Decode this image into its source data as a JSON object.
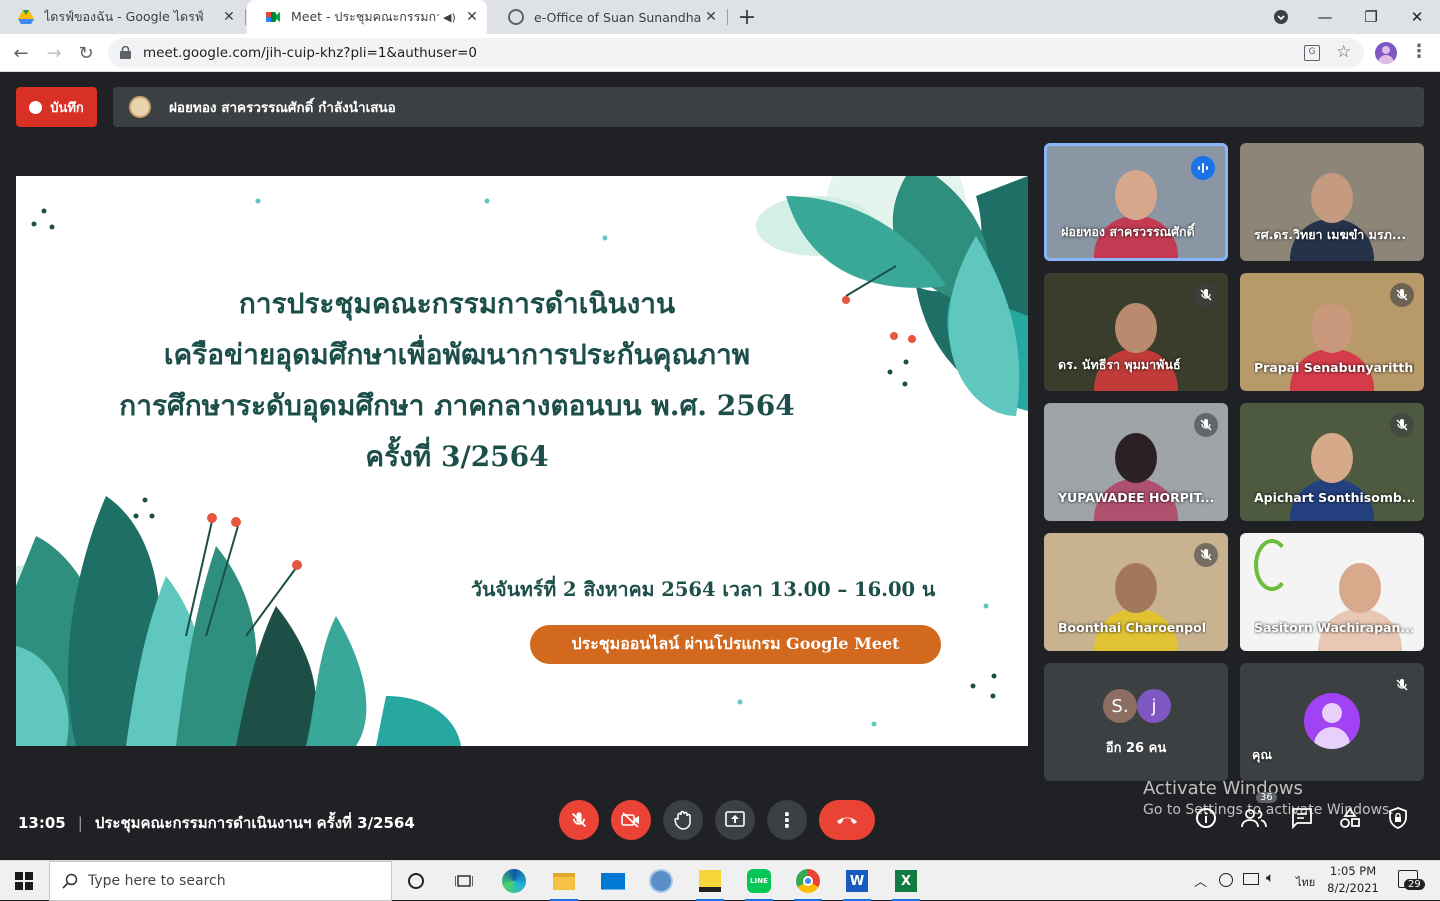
{
  "browser": {
    "tabs": [
      {
        "title": "ไดรฟ์ของฉัน - Google ไดรฟ์",
        "active": false
      },
      {
        "title": "Meet - ประชุมคณะกรรมการดำเนิ",
        "active": true
      },
      {
        "title": "e-Office of Suan Sunandha Rajab",
        "active": false
      }
    ],
    "url": "meet.google.com/jih-cuip-khz?pli=1&authuser=0"
  },
  "meet": {
    "record_label": "บันทึก",
    "presenter_text": "ฝอยทอง สาครวรรณศักดิ์ กำลังนำเสนอ",
    "slide": {
      "title_lines": [
        "การประชุมคณะกรรมการดำเนินงาน",
        "เครือข่ายอุดมศึกษาเพื่อพัฒนาการประกันคุณภาพ",
        "การศึกษาระดับอุดมศึกษา ภาคกลางตอนบน พ.ศ. 2564",
        "ครั้งที่ 3/2564"
      ],
      "date_line": "วันจันทร์ที่ 2 สิงหาคม 2564 เวลา 13.00 – 16.00 น",
      "online_button": "ประชุมออนไลน์ ผ่านโปรแกรม Google Meet"
    },
    "participants": [
      {
        "name": "ฝอยทอง สาครวรรณศักดิ์",
        "muted": false,
        "speaking": true
      },
      {
        "name": "รศ.ดร.วิทยา เมฆขำ มรภ...",
        "muted": false,
        "speaking": false
      },
      {
        "name": "ดร. นัทธีรา พุมมาพันธ์",
        "muted": true,
        "speaking": false
      },
      {
        "name": "Prapai Senabunyaritthi",
        "muted": true,
        "speaking": false
      },
      {
        "name": "YUPAWADEE HORPIT...",
        "muted": true,
        "speaking": false
      },
      {
        "name": "Apichart Sonthisomb...",
        "muted": true,
        "speaking": false
      },
      {
        "name": "Boonthai Charoenpol",
        "muted": true,
        "speaking": false
      },
      {
        "name": "Sasitorn Wachirapan...",
        "muted": false,
        "speaking": false
      }
    ],
    "others": {
      "avatars": [
        "S.",
        "j"
      ],
      "label": "อีก 26 คน"
    },
    "self_tile": {
      "name": "คุณ"
    },
    "meeting_time": "13:05",
    "meeting_title": "ประชุมคณะกรรมการดำเนินงานฯ ครั้งที่ 3/2564",
    "people_count": "36",
    "watermark_title": "Activate Windows",
    "watermark_sub": "Go to Settings to activate Windows."
  },
  "taskbar": {
    "search_placeholder": "Type here to search",
    "time": "1:05 PM",
    "date": "8/2/2021",
    "language": "ไทย",
    "notifications": "29"
  }
}
